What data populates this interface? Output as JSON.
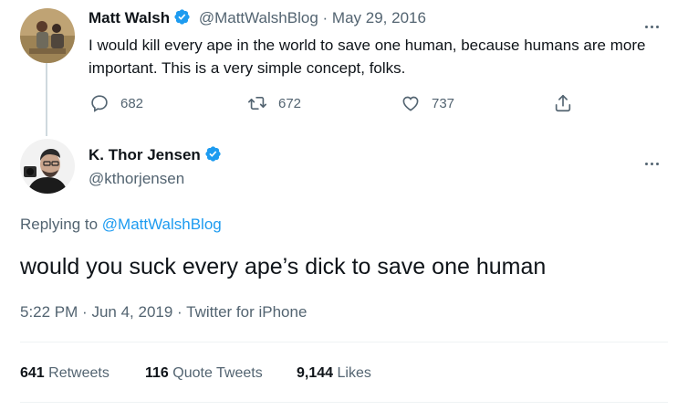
{
  "colors": {
    "text": "#0f1419",
    "muted": "#536471",
    "accent": "#1d9bf0",
    "divider": "#eff3f4"
  },
  "parent_tweet": {
    "author_name": "Matt Walsh",
    "handle": "@MattWalshBlog",
    "separator": "·",
    "date": "May 29, 2016",
    "text": "I would kill every ape in the world to save one human, because humans are more important. This is a very simple concept, folks.",
    "actions": [
      {
        "icon": "reply-icon",
        "count": "682"
      },
      {
        "icon": "retweet-icon",
        "count": "672"
      },
      {
        "icon": "heart-icon",
        "count": "737"
      },
      {
        "icon": "share-icon",
        "count": ""
      }
    ]
  },
  "main_tweet": {
    "author_name": "K. Thor Jensen",
    "handle": "@kthorjensen",
    "replying_prefix": "Replying to ",
    "replying_to": "@MattWalshBlog",
    "text": "would you suck every ape’s dick to save one human",
    "time": "5:22 PM",
    "date": "Jun 4, 2019",
    "source": "Twitter for iPhone",
    "meta_separator": "·",
    "stats": {
      "retweets_count": "641",
      "retweets_label": "Retweets",
      "quotes_count": "116",
      "quotes_label": "Quote Tweets",
      "likes_count": "9,144",
      "likes_label": "Likes"
    }
  }
}
